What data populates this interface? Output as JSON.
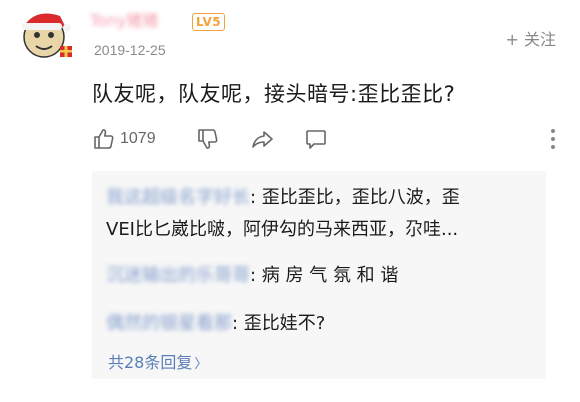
{
  "comment": {
    "username": "Tony猪猪",
    "level": "LV5",
    "date": "2019-12-25",
    "follow_label": "+ 关注",
    "text": "队友呢，队友呢，接头暗号:歪比歪比?",
    "like_count": "1079"
  },
  "replies": [
    {
      "name": "我这超级名字好长",
      "text_line1": ": 歪比歪比，歪比八波，歪",
      "text_line2": "VEI比匕崴比啵，阿伊勾的马来西亚，尕哇..."
    },
    {
      "name": "沉迷输出的乐哥哥",
      "text": ": 病 房 气 氛 和 谐"
    },
    {
      "name": "偶然的银星看那",
      "text": ": 歪比娃不?"
    }
  ],
  "more_replies_label": "共28条回复",
  "more_replies_arrow": "〉",
  "colors": {
    "accent_blue": "#5a7fb8",
    "level_orange": "#f4a23c",
    "username_pink": "#f28b9e"
  }
}
